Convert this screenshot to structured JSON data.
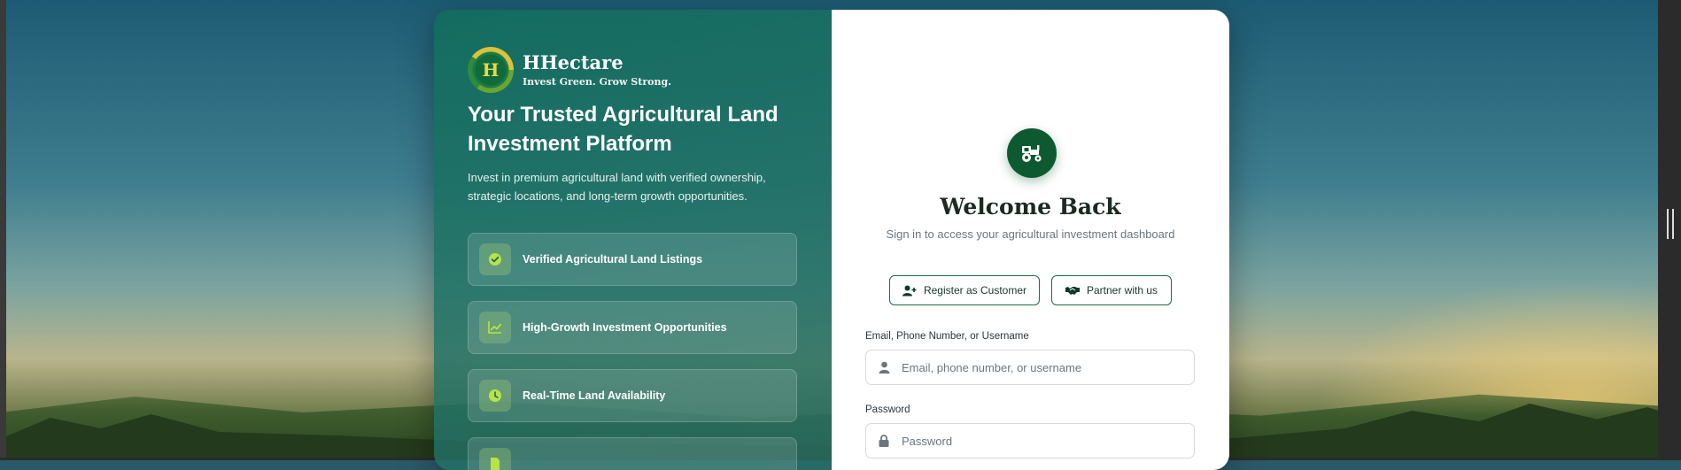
{
  "brand": {
    "name": "HHectare",
    "tagline": "Invest Green. Grow Strong.",
    "logo_letter": "H"
  },
  "hero": {
    "title": "Your Trusted Agricultural Land Investment Platform",
    "description": "Invest in premium agricultural land with verified ownership, strategic locations, and long-term growth opportunities."
  },
  "features": [
    {
      "label": "Verified Agricultural Land Listings",
      "icon": "check-circle-icon"
    },
    {
      "label": "High-Growth Investment Opportunities",
      "icon": "chart-line-icon"
    },
    {
      "label": "Real-Time Land Availability",
      "icon": "clock-icon"
    },
    {
      "label": "",
      "icon": "document-icon"
    }
  ],
  "login": {
    "icon": "tractor-icon",
    "title": "Welcome Back",
    "subtitle": "Sign in to access your agricultural investment dashboard",
    "register_label": "Register as Customer",
    "partner_label": "Partner with us",
    "identifier_label": "Email, Phone Number, or Username",
    "identifier_placeholder": "Email, phone number, or username",
    "password_label": "Password",
    "password_placeholder": "Password"
  },
  "colors": {
    "brand_green": "#0d5a30",
    "panel_teal": "#1e7064",
    "feature_icon": "#b6e34a"
  }
}
